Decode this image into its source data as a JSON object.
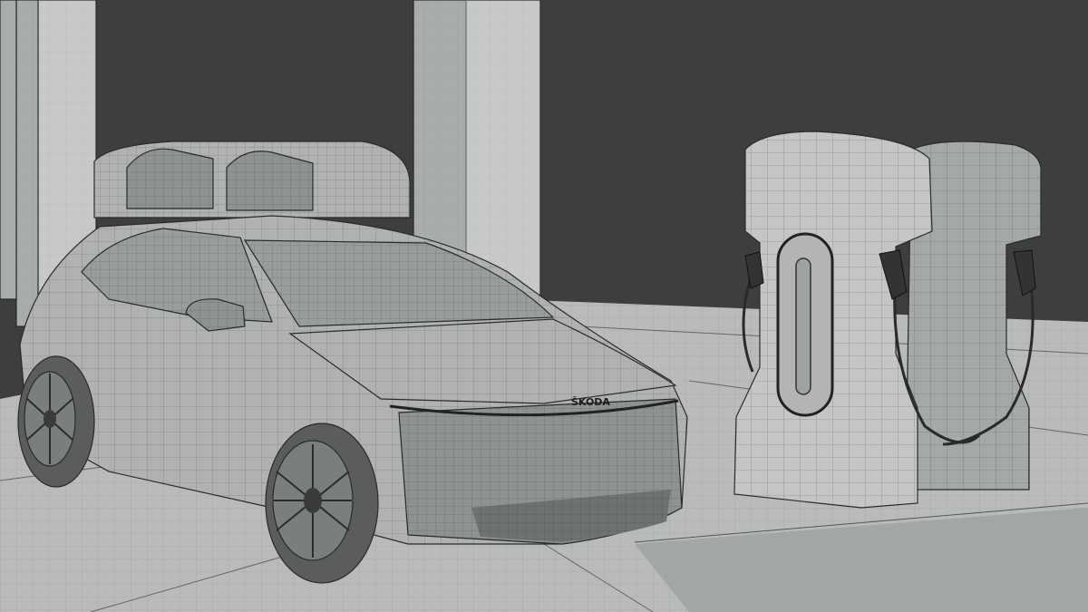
{
  "scene": {
    "subject": "wireframe-render",
    "badge_text": "ŠKODA",
    "colors": {
      "background": "#3e3e3e",
      "floor": "#b9bbbb",
      "floor_dark": "#a3a6a6",
      "pillar": "#c7c9c9",
      "pillar_shade": "#a9acac",
      "car_body": "#b0b2b2",
      "car_shade": "#8f9292",
      "glass": "#9a9d9d",
      "charger": "#c4c6c6",
      "charger_shade": "#a5a8a8",
      "wire": "#2a2a2a",
      "tire": "#5b5d5d",
      "rim": "#7b7e7e"
    }
  }
}
